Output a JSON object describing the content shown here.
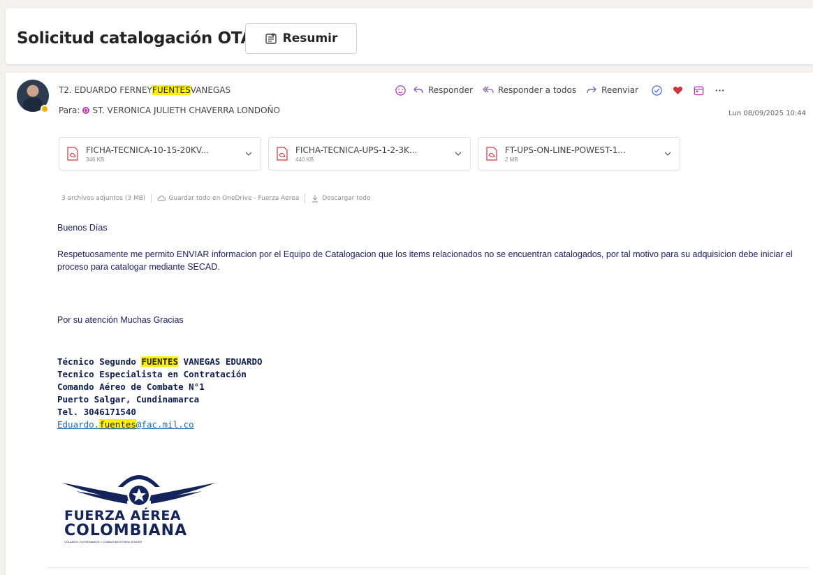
{
  "message": {
    "subject": "Solicitud catalogación OTAN",
    "summarize_label": "Resumir",
    "from_prefix": "T2. EDUARDO FERNEY",
    "from_highlight": "FUENTES",
    "from_suffix": "VANEGAS",
    "to_label": "Para:",
    "to_name": "ST. VERONICA JULIETH CHAVERRA LONDOÑO",
    "date": "Lun 08/09/2025 10:44"
  },
  "actions": {
    "reply": "Responder",
    "reply_all": "Responder a todos",
    "forward": "Reenviar"
  },
  "attachments": [
    {
      "name": "FICHA-TECNICA-10-15-20KV...",
      "size": "346 KB"
    },
    {
      "name": "FICHA-TECNICA-UPS-1-2-3K...",
      "size": "440 KB"
    },
    {
      "name": "FT-UPS-ON-LINE-POWEST-1...",
      "size": "2 MB"
    }
  ],
  "attachment_bar": {
    "summary": "3 archivos adjuntos (3 MB)",
    "save_onedrive": "Guardar todo en OneDrive - Fuerza Aerea",
    "download_all": "Descargar todo"
  },
  "body": {
    "greeting": "Buenos Días",
    "paragraph": "Respetuosamente me permito ENVIAR informacion por el Equipo de Catalogacion que los items relacionados no se encuentran catalogados, por tal motivo para su adquisicion debe iniciar el proceso para catalogar mediante SECAD.",
    "thanks": "Por su atención Muchas Gracias"
  },
  "signature": {
    "line1_prefix": "Técnico Segundo ",
    "line1_highlight": "FUENTES",
    "line1_suffix": " VANEGAS EDUARDO",
    "line2": "Tecnico Especialista en Contratación",
    "line3": "Comando Aéreo de Combate N°1",
    "line4": "Puerto Salgar, Cundinamarca",
    "line5": "Tel. 3046171540",
    "email_prefix": "Eduardo.",
    "email_highlight": "fuentes",
    "email_suffix": "@fac.mil.co"
  },
  "logo": {
    "line1": "FUERZA AÉREA",
    "line2": "COLOMBIANA",
    "tagline": "VOLAMOS, ENTRENAMOS Y COMBATIMOS PARA VENCER"
  },
  "colors": {
    "highlight": "#fff100",
    "body_text": "#1b1b6e",
    "link": "#1a6fb5",
    "logo_navy": "#13245a"
  }
}
